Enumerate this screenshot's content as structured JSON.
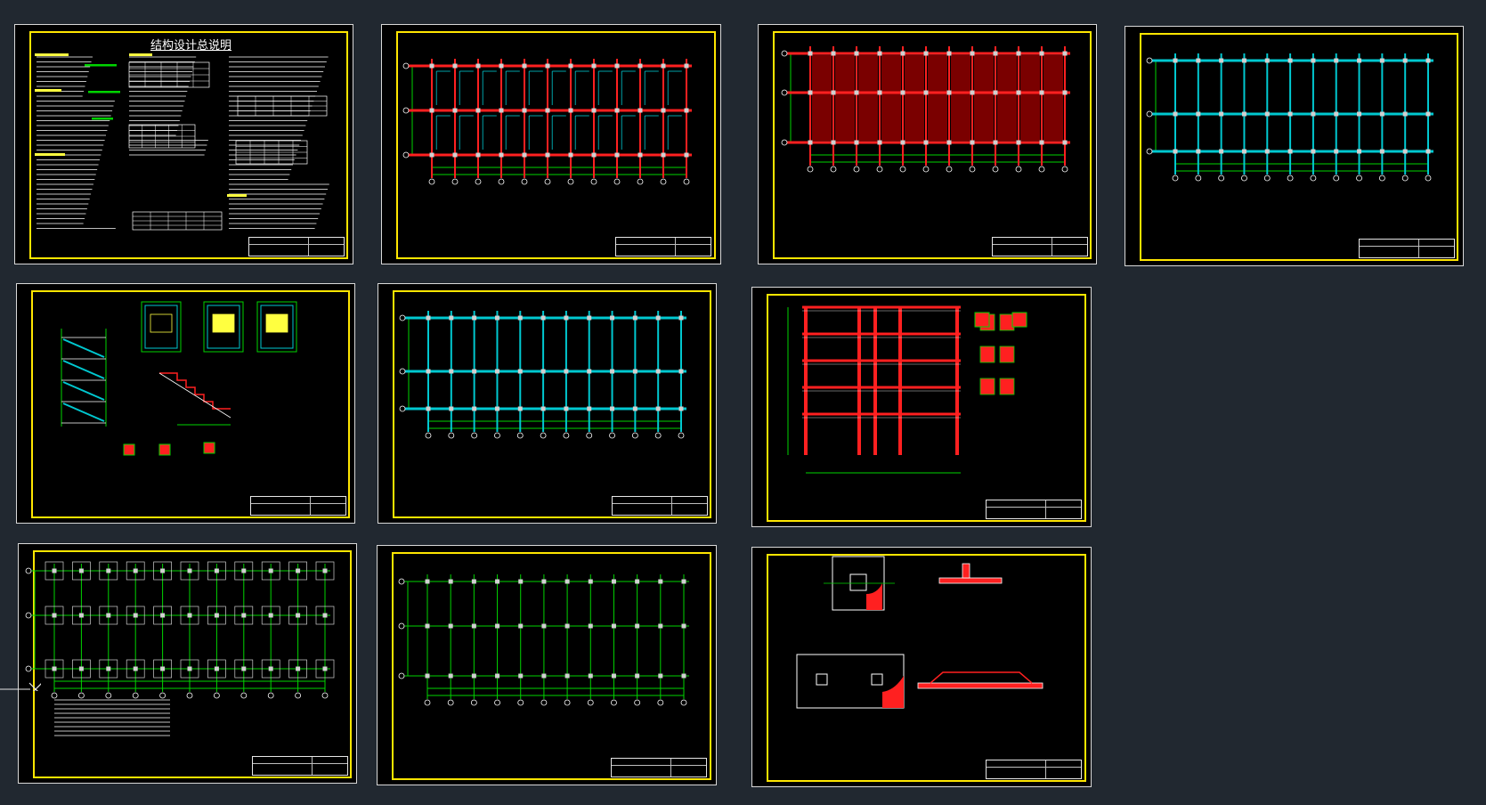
{
  "workspace": {
    "background": "#212830"
  },
  "colors": {
    "paper": "#000000",
    "frame": "#ffe600",
    "grid": "#00d400",
    "beam": "#ff2020",
    "column": "#d0d0d0",
    "slab": "#00c8d0",
    "text": "#ffffff",
    "highlight": "#ffff40"
  },
  "sheets": [
    {
      "kind": "notes",
      "title": "结构设计总说明"
    },
    {
      "kind": "plan-redgrid"
    },
    {
      "kind": "plan-redfill"
    },
    {
      "kind": "plan-cyan"
    },
    {
      "kind": "stair"
    },
    {
      "kind": "plan-cyan"
    },
    {
      "kind": "frame-elevation"
    },
    {
      "kind": "foundation"
    },
    {
      "kind": "plan-columns"
    },
    {
      "kind": "footing-detail"
    }
  ],
  "icons": {
    "cursor": "crosshair-cursor-icon"
  }
}
